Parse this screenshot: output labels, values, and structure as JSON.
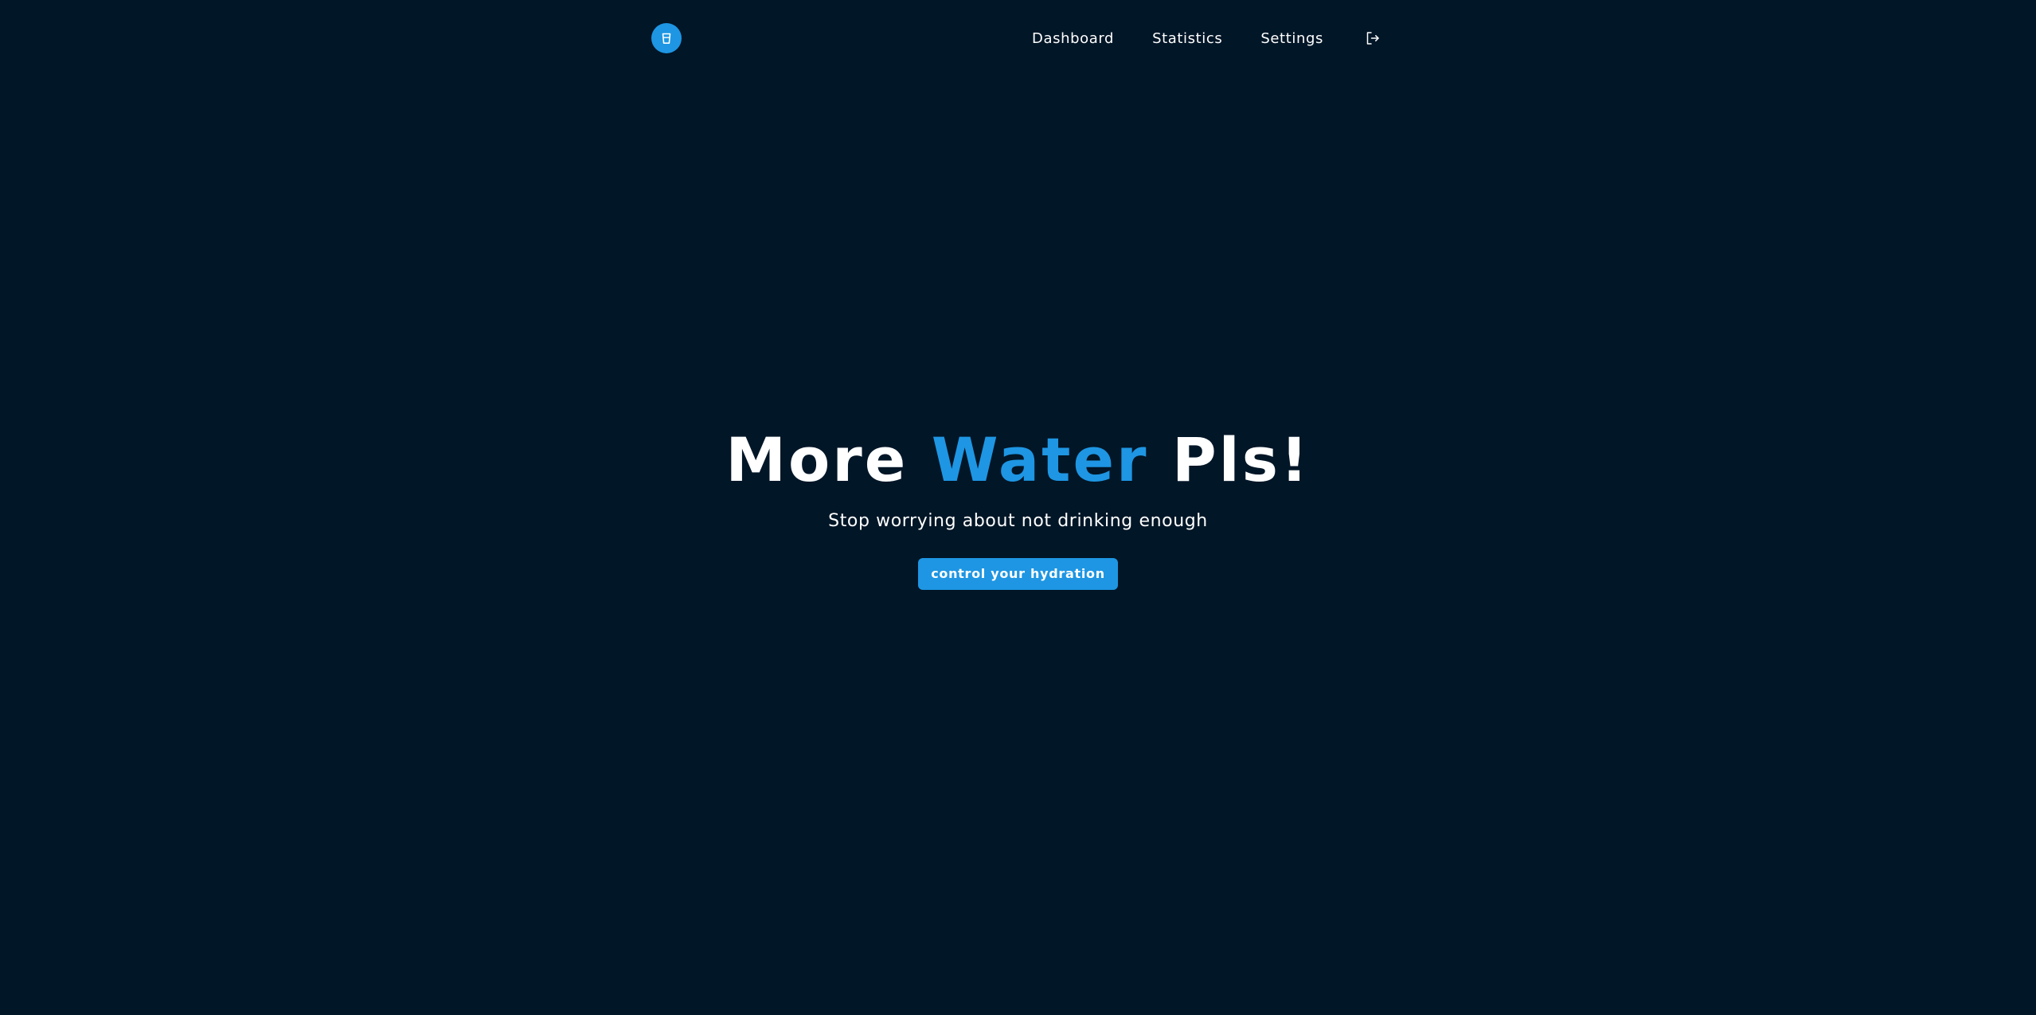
{
  "colors": {
    "background": "#011627",
    "accent": "#1e96e3",
    "text": "#ffffff"
  },
  "navbar": {
    "logo_icon": "water-glass-icon",
    "links": [
      {
        "label": "Dashboard"
      },
      {
        "label": "Statistics"
      },
      {
        "label": "Settings"
      }
    ],
    "logout_icon": "logout-icon"
  },
  "hero": {
    "title_before": "More",
    "title_accent": "Water",
    "title_after": "Pls!",
    "subtitle": "Stop worrying about not drinking enough",
    "cta_label": "control your hydration"
  }
}
